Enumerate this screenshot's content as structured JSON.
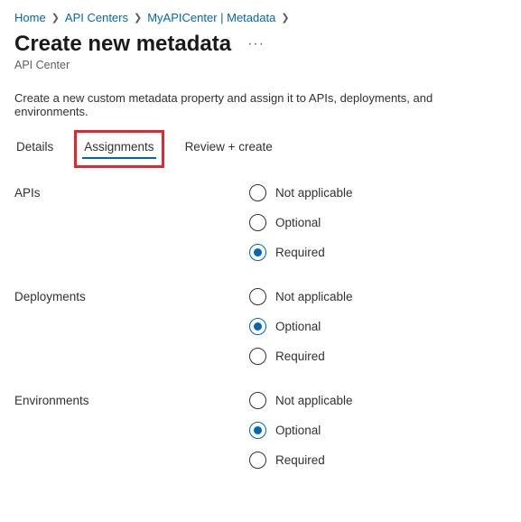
{
  "breadcrumb": {
    "home": "Home",
    "api_centers": "API Centers",
    "current": "MyAPICenter | Metadata"
  },
  "header": {
    "title": "Create new metadata",
    "subtitle": "API Center",
    "more_label": "···"
  },
  "description": "Create a new custom metadata property and assign it to APIs, deployments, and environments.",
  "tabs": {
    "details": "Details",
    "assignments": "Assignments",
    "review": "Review + create"
  },
  "radio_options": {
    "na": "Not applicable",
    "opt": "Optional",
    "req": "Required"
  },
  "groups": {
    "apis": {
      "label": "APIs",
      "selected": "req"
    },
    "deployments": {
      "label": "Deployments",
      "selected": "opt"
    },
    "environments": {
      "label": "Environments",
      "selected": "opt"
    }
  }
}
